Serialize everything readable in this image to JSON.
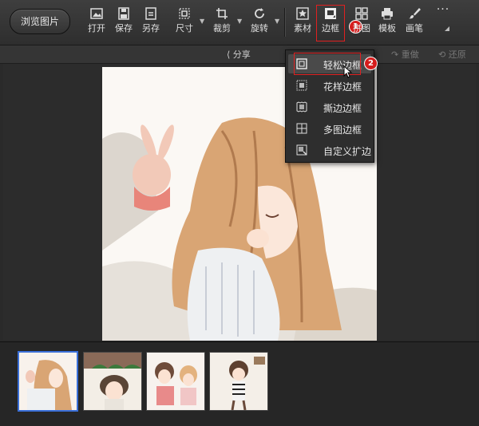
{
  "toolbar": {
    "browse_label": "浏览图片",
    "tools": [
      {
        "label": "打开",
        "icon": "open-image-icon"
      },
      {
        "label": "保存",
        "icon": "save-icon"
      },
      {
        "label": "另存",
        "icon": "save-as-icon"
      },
      {
        "label": "尺寸",
        "icon": "resize-icon"
      },
      {
        "label": "裁剪",
        "icon": "crop-icon"
      },
      {
        "label": "旋转",
        "icon": "rotate-icon"
      },
      {
        "label": "素材",
        "icon": "sticker-star-icon"
      },
      {
        "label": "边框",
        "icon": "frame-icon"
      },
      {
        "label": "拼图",
        "icon": "collage-grid-icon"
      },
      {
        "label": "模板",
        "icon": "printer-template-icon"
      },
      {
        "label": "画笔",
        "icon": "brush-icon"
      },
      {
        "label": "···",
        "icon": "more-icon"
      }
    ],
    "markers": [
      "1",
      "2"
    ],
    "highlight_color": "#e02020"
  },
  "subbar": {
    "share_label": "分享",
    "redo_label": "重做",
    "restore_label": "还原"
  },
  "dropdown": {
    "items": [
      {
        "label": "轻松边框",
        "icon": "simple-frame-icon",
        "selected": true
      },
      {
        "label": "花样边框",
        "icon": "pattern-frame-icon"
      },
      {
        "label": "撕边边框",
        "icon": "torn-edge-frame-icon"
      },
      {
        "label": "多图边框",
        "icon": "multi-image-frame-icon"
      },
      {
        "label": "自定义扩边",
        "icon": "custom-extend-icon"
      }
    ]
  },
  "filmstrip": {
    "selected_index": 0,
    "count": 4
  }
}
